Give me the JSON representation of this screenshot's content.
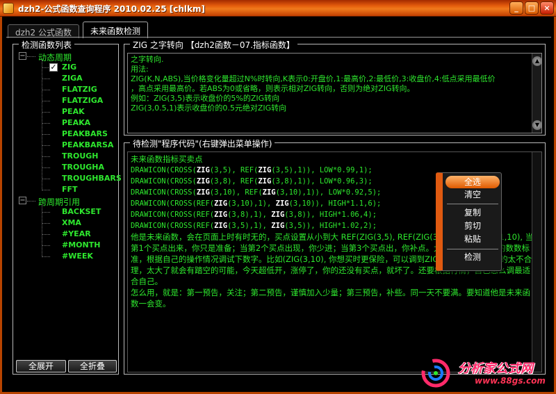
{
  "window": {
    "title": "dzh2-公式函数查询程序 2010.02.25 [chlkm]",
    "minimize_label": "_",
    "restore_label": "□",
    "close_label": "×"
  },
  "tabs": [
    "dzh2 公式函数",
    "未来函数检测"
  ],
  "left_panel": {
    "title": "检测函数列表",
    "folders": [
      {
        "label": "动态周期",
        "expander": "−",
        "items": [
          "ZIG",
          "ZIGA",
          "FLATZIG",
          "FLATZIGA",
          "PEAK",
          "PEAKA",
          "PEAKBARS",
          "PEAKBARSA",
          "TROUGH",
          "TROUGHA",
          "TROUGHBARS",
          "FFT"
        ]
      },
      {
        "label": "跨周期引用",
        "expander": "−",
        "items": [
          "BACKSET",
          "XMA",
          "#YEAR",
          "#MONTH",
          "#WEEK"
        ]
      }
    ],
    "checked_mark": "✓",
    "expand_all": "全展开",
    "collapse_all": "全折叠"
  },
  "desc_panel": {
    "title": "ZIG 之字转向 【dzh2函数－07.指标函数】",
    "lines": [
      "之字转向.",
      "用法:",
      "ZIG(K,N,ABS),当价格变化量超过N%时转向,K表示0:开盘价,1:最高价,2:最低价,3:收盘价,4:低点采用最低价",
      "，高点采用最高价。若ABS为0或省略，则表示相对ZIG转向，否则为绝对ZIG转向。",
      "例如：ZIG(3,5)表示收盘价的5%的ZIG转向",
      "ZIG(3,0.5,1)表示收盘价的0.5元绝对ZIG转向"
    ]
  },
  "code_panel": {
    "title": "待检测\"程序代码\"(右键弹出菜单操作)",
    "heading": "未来函数指标买卖点",
    "code_lines": [
      [
        "DRAWICON(CROSS(",
        "ZIG",
        "(3,5), REF(",
        "ZIG",
        "(3,5),1)), LOW*0.99,1);"
      ],
      [
        "DRAWICON(CROSS(",
        "ZIG",
        "(3,8), REF(",
        "ZIG",
        "(3,8),1)), LOW*0.96,3);"
      ],
      [
        "DRAWICON(CROSS(",
        "ZIG",
        "(3,10), REF(",
        "ZIG",
        "(3,10),1)), LOW*0.92,5);"
      ],
      [
        "DRAWICON(CROSS(REF(",
        "ZIG",
        "(3,10),1), ",
        "ZIG",
        "(3,10)), HIGH*1.1,6);"
      ],
      [
        "DRAWICON(CROSS(REF(",
        "ZIG",
        "(3,8),1), ",
        "ZIG",
        "(3,8)), HIGH*1.06,4);"
      ],
      [
        "DRAWICON(CROSS(REF(",
        "ZIG",
        "(3,5),1), ",
        "ZIG",
        "(3,5)), HIGH*1.02,2);"
      ]
    ],
    "para1": "他是未来函数，会在页面上时有时无的，买点设置从小到大 REF(ZIG(3,5), REF(ZIG(3,10),1),HIGH*1.1,10), 当第1个买点出来，你只是准备；当第2个买点出现，你少进；当第3个买点出，你补点。大家不要按我设置的数数标准，根据自己的操作情况调试下数字。比如(ZIG(3,10), 你想买时更保险，可以调到ZIG(3,12), 但不要调的太不合理，太大了就会有踏空的可能，今天超低开，涨停了，你的还没有买点，就坏了。还要根据行情，自己怎么调最适合自己。",
    "para2": "怎么用，就是：第一预告，关注；第二预告，谨慎加入少量；第三预告，补些。同一天不要满。要知道他是未来函数一会变。"
  },
  "context_menu": {
    "items": [
      "全选",
      "清空",
      "复制",
      "剪切",
      "粘贴",
      "检测"
    ],
    "selected": "全选"
  },
  "logo": {
    "name": "分析家公式网",
    "url": "www.88gs.com"
  }
}
